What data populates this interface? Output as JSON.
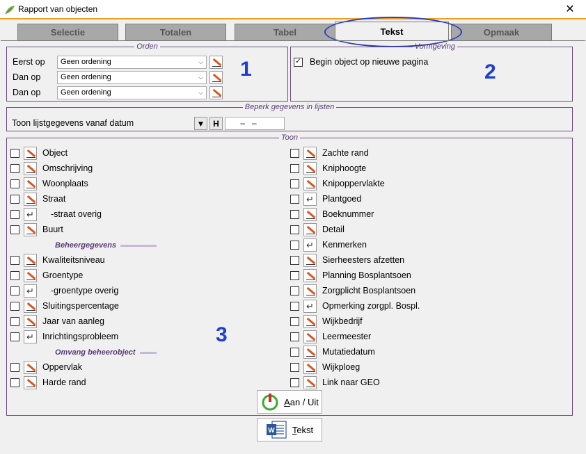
{
  "window": {
    "title": "Rapport van objecten",
    "close": "✕"
  },
  "tabs": [
    {
      "label": "Selectie"
    },
    {
      "label": "Totalen"
    },
    {
      "label": "Tabel"
    },
    {
      "label": "Tekst",
      "active": true
    },
    {
      "label": "Opmaak"
    }
  ],
  "orden": {
    "legend": "Orden",
    "rows": [
      {
        "label": "Eerst op",
        "value": "Geen ordening"
      },
      {
        "label": "Dan op",
        "value": "Geen ordening"
      },
      {
        "label": "Dan op",
        "value": "Geen ordening"
      }
    ]
  },
  "vormgeving": {
    "legend": "Vormgeving",
    "begin_label": "Begin object op nieuwe pagina",
    "begin_checked": true
  },
  "beperk": {
    "legend": "Beperk gegevens in lijsten",
    "label": "Toon lijstgegevens vanaf datum",
    "down_btn": "▼",
    "h_btn": "H",
    "date": " –   – "
  },
  "toon": {
    "legend": "Toon",
    "left_items": [
      {
        "label": "Object",
        "icon": "pen"
      },
      {
        "label": "Omschrijving",
        "icon": "pen"
      },
      {
        "label": "Woonplaats",
        "icon": "pen"
      },
      {
        "label": "Straat",
        "icon": "pen"
      },
      {
        "label": "-straat overig",
        "icon": "enter"
      },
      {
        "label": "Buurt",
        "icon": "pen"
      },
      {
        "header": "Beheergegevens"
      },
      {
        "label": "Kwaliteitsniveau",
        "icon": "pen"
      },
      {
        "label": "Groentype",
        "icon": "pen"
      },
      {
        "label": "-groentype overig",
        "icon": "enter"
      },
      {
        "label": "Sluitingspercentage",
        "icon": "pen"
      },
      {
        "label": "Jaar van aanleg",
        "icon": "pen"
      },
      {
        "label": "Inrichtingsprobleem",
        "icon": "enter"
      },
      {
        "header": "Omvang beheerobject"
      },
      {
        "label": "Oppervlak",
        "icon": "pen"
      },
      {
        "label": "Harde rand",
        "icon": "pen"
      }
    ],
    "right_items": [
      {
        "label": "Zachte rand",
        "icon": "pen"
      },
      {
        "label": "Kniphoogte",
        "icon": "pen"
      },
      {
        "label": "Knipoppervlakte",
        "icon": "pen"
      },
      {
        "label": "Plantgoed",
        "icon": "enter"
      },
      {
        "label": "Boeknummer",
        "icon": "pen"
      },
      {
        "label": "Detail",
        "icon": "pen"
      },
      {
        "label": "Kenmerken",
        "icon": "enter"
      },
      {
        "label": "Sierheesters afzetten",
        "icon": "pen"
      },
      {
        "label": "Planning Bosplantsoen",
        "icon": "pen"
      },
      {
        "label": "Zorgplicht Bosplantsoen",
        "icon": "pen"
      },
      {
        "label": "Opmerking zorgpl. Bospl.",
        "icon": "enter"
      },
      {
        "label": "Wijkbedrijf",
        "icon": "pen"
      },
      {
        "label": "Leermeester",
        "icon": "pen"
      },
      {
        "label": "Mutatiedatum",
        "icon": "pen"
      },
      {
        "label": "Wijkploeg",
        "icon": "pen"
      },
      {
        "label": "Link naar GEO",
        "icon": "pen"
      }
    ]
  },
  "annotations": {
    "one": "1",
    "two": "2",
    "three": "3"
  },
  "buttons": {
    "aan_uit_mnemonic": "A",
    "aan_uit_rest": "an / Uit",
    "tekst_mnemonic": "T",
    "tekst_rest": "ekst"
  },
  "colors": {
    "accent": "#f0a020",
    "legend": "#5a3a77",
    "annotation": "#1f3fd0",
    "pen": "#e0531a"
  }
}
